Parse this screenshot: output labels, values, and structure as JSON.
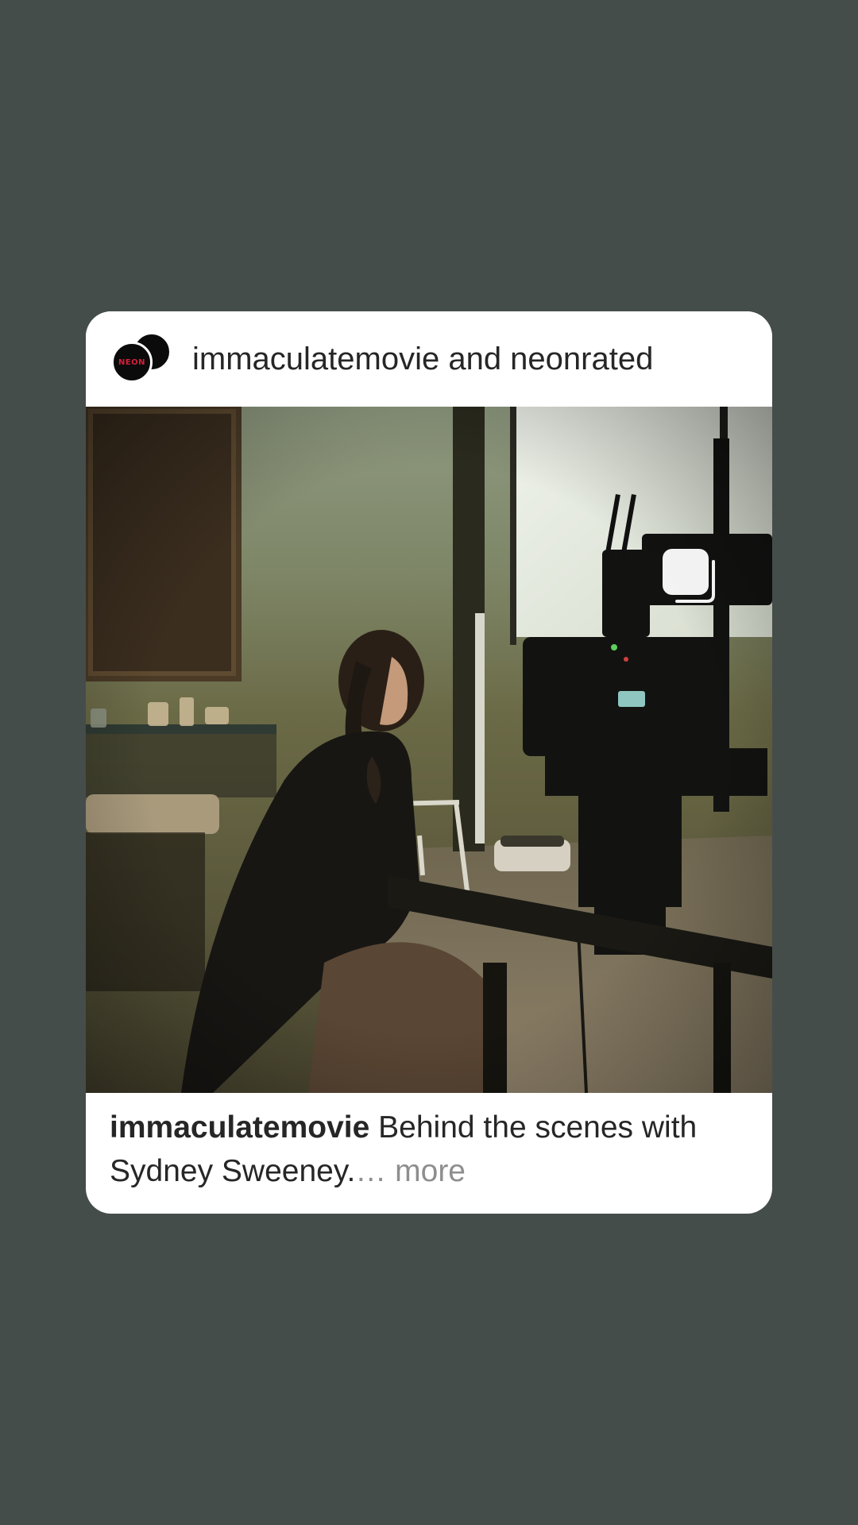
{
  "post": {
    "header": {
      "accounts": "immaculatemovie and neonrated",
      "avatar_front_logo": "NEON"
    },
    "caption": {
      "username": "immaculatemovie",
      "text": "Behind the scenes with Sydney Sweeney.",
      "ellipsis": "…",
      "more_label": "more"
    },
    "icons": {
      "multi_post": "carousel-icon"
    }
  },
  "colors": {
    "background": "#454d4b",
    "card": "#ffffff",
    "text": "#262626",
    "muted": "#8e8e8e",
    "neon_red": "#d4203b"
  }
}
